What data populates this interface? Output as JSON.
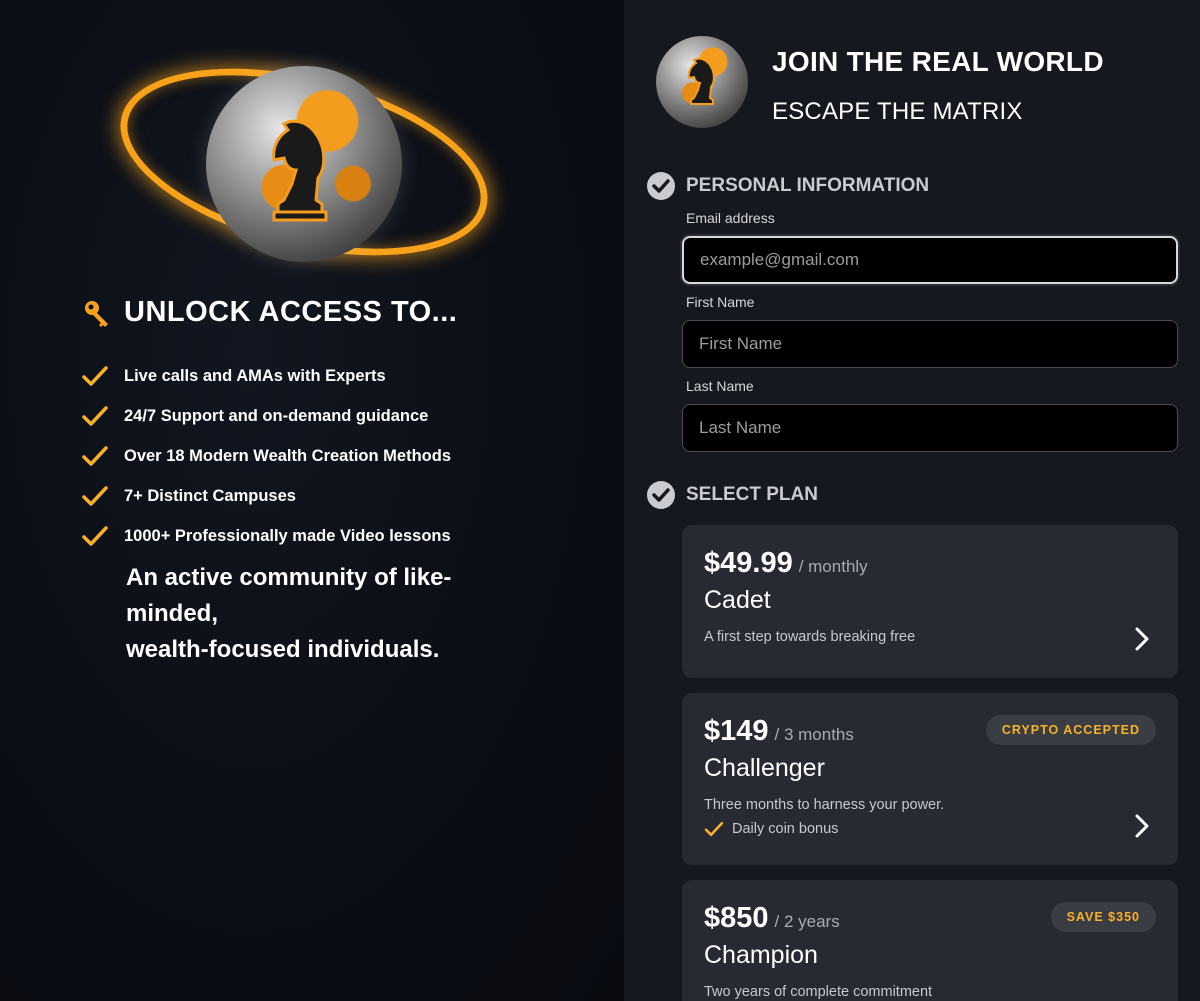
{
  "brand": {
    "accent": "#f7a21a",
    "page_bg": "#0b0e15",
    "panel_bg": "#15181f",
    "card_bg": "#272a33"
  },
  "left": {
    "unlock_title": "UNLOCK ACCESS TO...",
    "features": [
      "Live calls and AMAs with Experts",
      "24/7 Support and on-demand guidance",
      "Over 18 Modern Wealth Creation Methods",
      "7+ Distinct Campuses",
      "1000+ Professionally made Video lessons"
    ],
    "community_line1": "An active community of like-",
    "community_line2": "minded,",
    "community_line3": "wealth-focused individuals."
  },
  "header": {
    "title": "JOIN THE REAL WORLD",
    "subtitle": "ESCAPE THE MATRIX"
  },
  "personal": {
    "heading": "PERSONAL INFORMATION",
    "email_label": "Email address",
    "email_placeholder": "example@gmail.com",
    "first_label": "First Name",
    "first_placeholder": "First Name",
    "last_label": "Last Name",
    "last_placeholder": "Last Name"
  },
  "plans": {
    "heading": "SELECT PLAN",
    "items": [
      {
        "price": "$49.99",
        "period": "/ monthly",
        "name": "Cadet",
        "desc": "A first step towards breaking free"
      },
      {
        "price": "$149",
        "period": "/ 3 months",
        "name": "Challenger",
        "desc": "Three months to harness your power.",
        "bonus": "Daily coin bonus",
        "badge": "CRYPTO ACCEPTED"
      },
      {
        "price": "$850",
        "period": "/ 2 years",
        "name": "Champion",
        "desc": "Two years of complete commitment",
        "badge": "SAVE $350"
      }
    ]
  }
}
